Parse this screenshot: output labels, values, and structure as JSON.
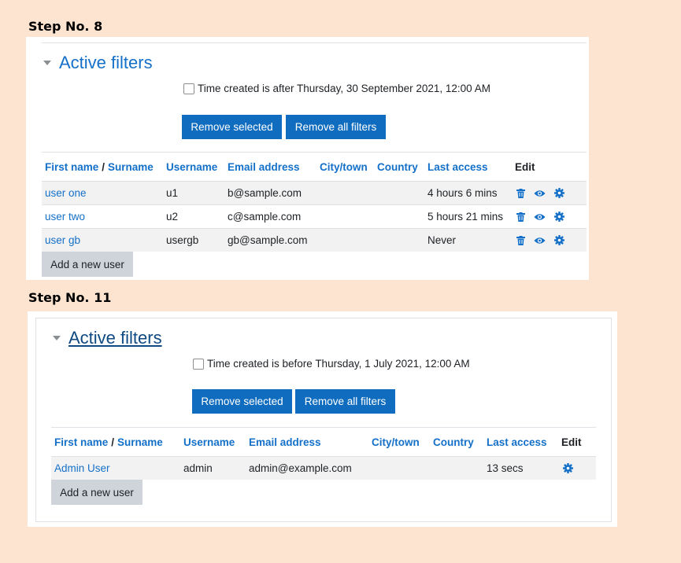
{
  "step8": {
    "label": "Step No. 8",
    "filters_title": "Active filters",
    "filter_text": "Time created is after Thursday, 30 September 2021, 12:00 AM",
    "remove_selected": "Remove selected",
    "remove_all": "Remove all filters",
    "headers": {
      "first_name": "First name",
      "sep": "/",
      "surname": "Surname",
      "username": "Username",
      "email": "Email address",
      "city": "City/town",
      "country": "Country",
      "last_access": "Last access",
      "edit": "Edit"
    },
    "rows": [
      {
        "name": "user one",
        "username": "u1",
        "email": "b@sample.com",
        "city": "",
        "country": "",
        "last_access": "4 hours 6 mins"
      },
      {
        "name": "user two",
        "username": "u2",
        "email": "c@sample.com",
        "city": "",
        "country": "",
        "last_access": "5 hours 21 mins"
      },
      {
        "name": "user gb",
        "username": "usergb",
        "email": "gb@sample.com",
        "city": "",
        "country": "",
        "last_access": "Never"
      }
    ],
    "add_user": "Add a new user"
  },
  "step11": {
    "label": "Step No. 11",
    "filters_title": "Active filters",
    "filter_text": "Time created is before Thursday, 1 July 2021, 12:00 AM",
    "remove_selected": "Remove selected",
    "remove_all": "Remove all filters",
    "headers": {
      "first_name": "First name",
      "sep": "/",
      "surname": "Surname",
      "username": "Username",
      "email": "Email address",
      "city": "City/town",
      "country": "Country",
      "last_access": "Last access",
      "edit": "Edit"
    },
    "rows": [
      {
        "name": "Admin User",
        "username": "admin",
        "email": "admin@example.com",
        "city": "",
        "country": "",
        "last_access": "13 secs"
      }
    ],
    "add_user": "Add a new user"
  },
  "icons": {
    "delete": "trash-icon",
    "view": "eye-icon",
    "edit": "gear-icon"
  },
  "colors": {
    "background": "#fde4d1",
    "link": "#1470c8",
    "primary_button": "#0f6cbf",
    "secondary_button": "#ced4da"
  }
}
